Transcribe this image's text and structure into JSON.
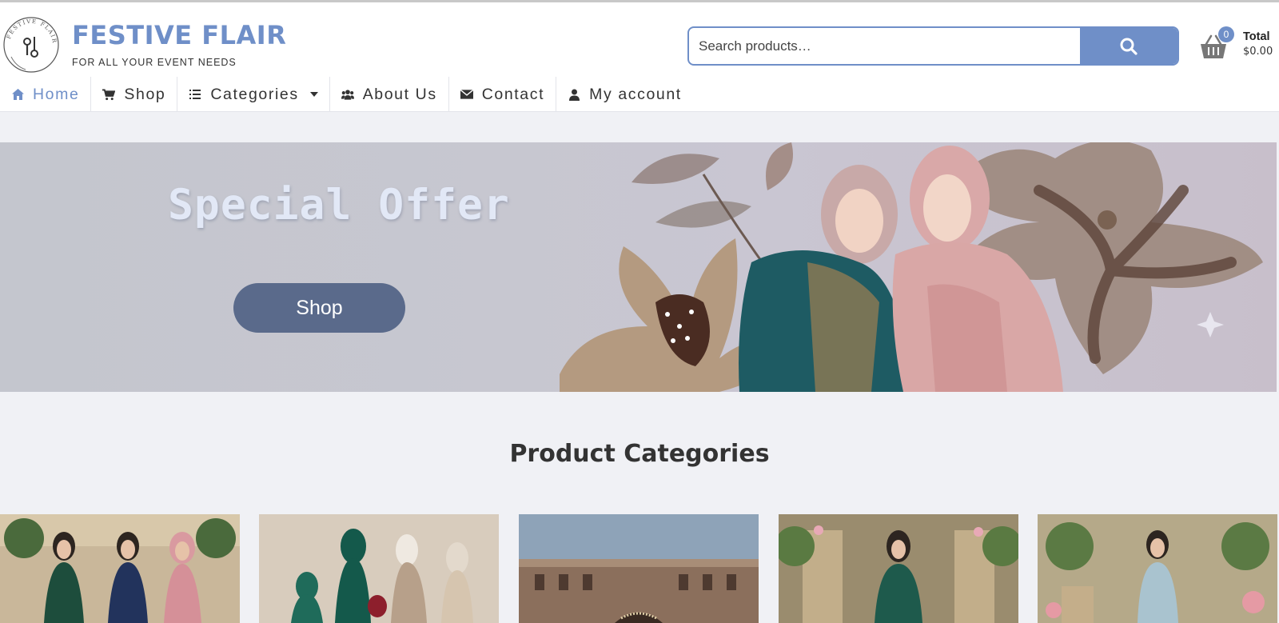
{
  "site": {
    "logo_text": "FESTIVE FLAIR",
    "brand": "FESTIVE FLAIR",
    "tagline": "FOR ALL YOUR EVENT NEEDS"
  },
  "search": {
    "placeholder": "Search products…",
    "value": ""
  },
  "cart": {
    "count": "0",
    "total_label": "Total",
    "total_value": "$0.00"
  },
  "nav": {
    "home": "Home",
    "shop": "Shop",
    "categories": "Categories",
    "about": "About Us",
    "contact": "Contact",
    "account": "My account"
  },
  "banner": {
    "title": "Special Offer",
    "button": "Shop"
  },
  "categories_section": {
    "title": "Product Categories"
  },
  "colors": {
    "accent": "#6f8fc8",
    "banner_button": "#5a6a8b",
    "page_bg": "#f0f1f5"
  },
  "icons": [
    "home-icon",
    "cart-icon",
    "list-icon",
    "caret-down-icon",
    "users-icon",
    "envelope-icon",
    "user-icon",
    "search-icon",
    "basket-icon"
  ]
}
